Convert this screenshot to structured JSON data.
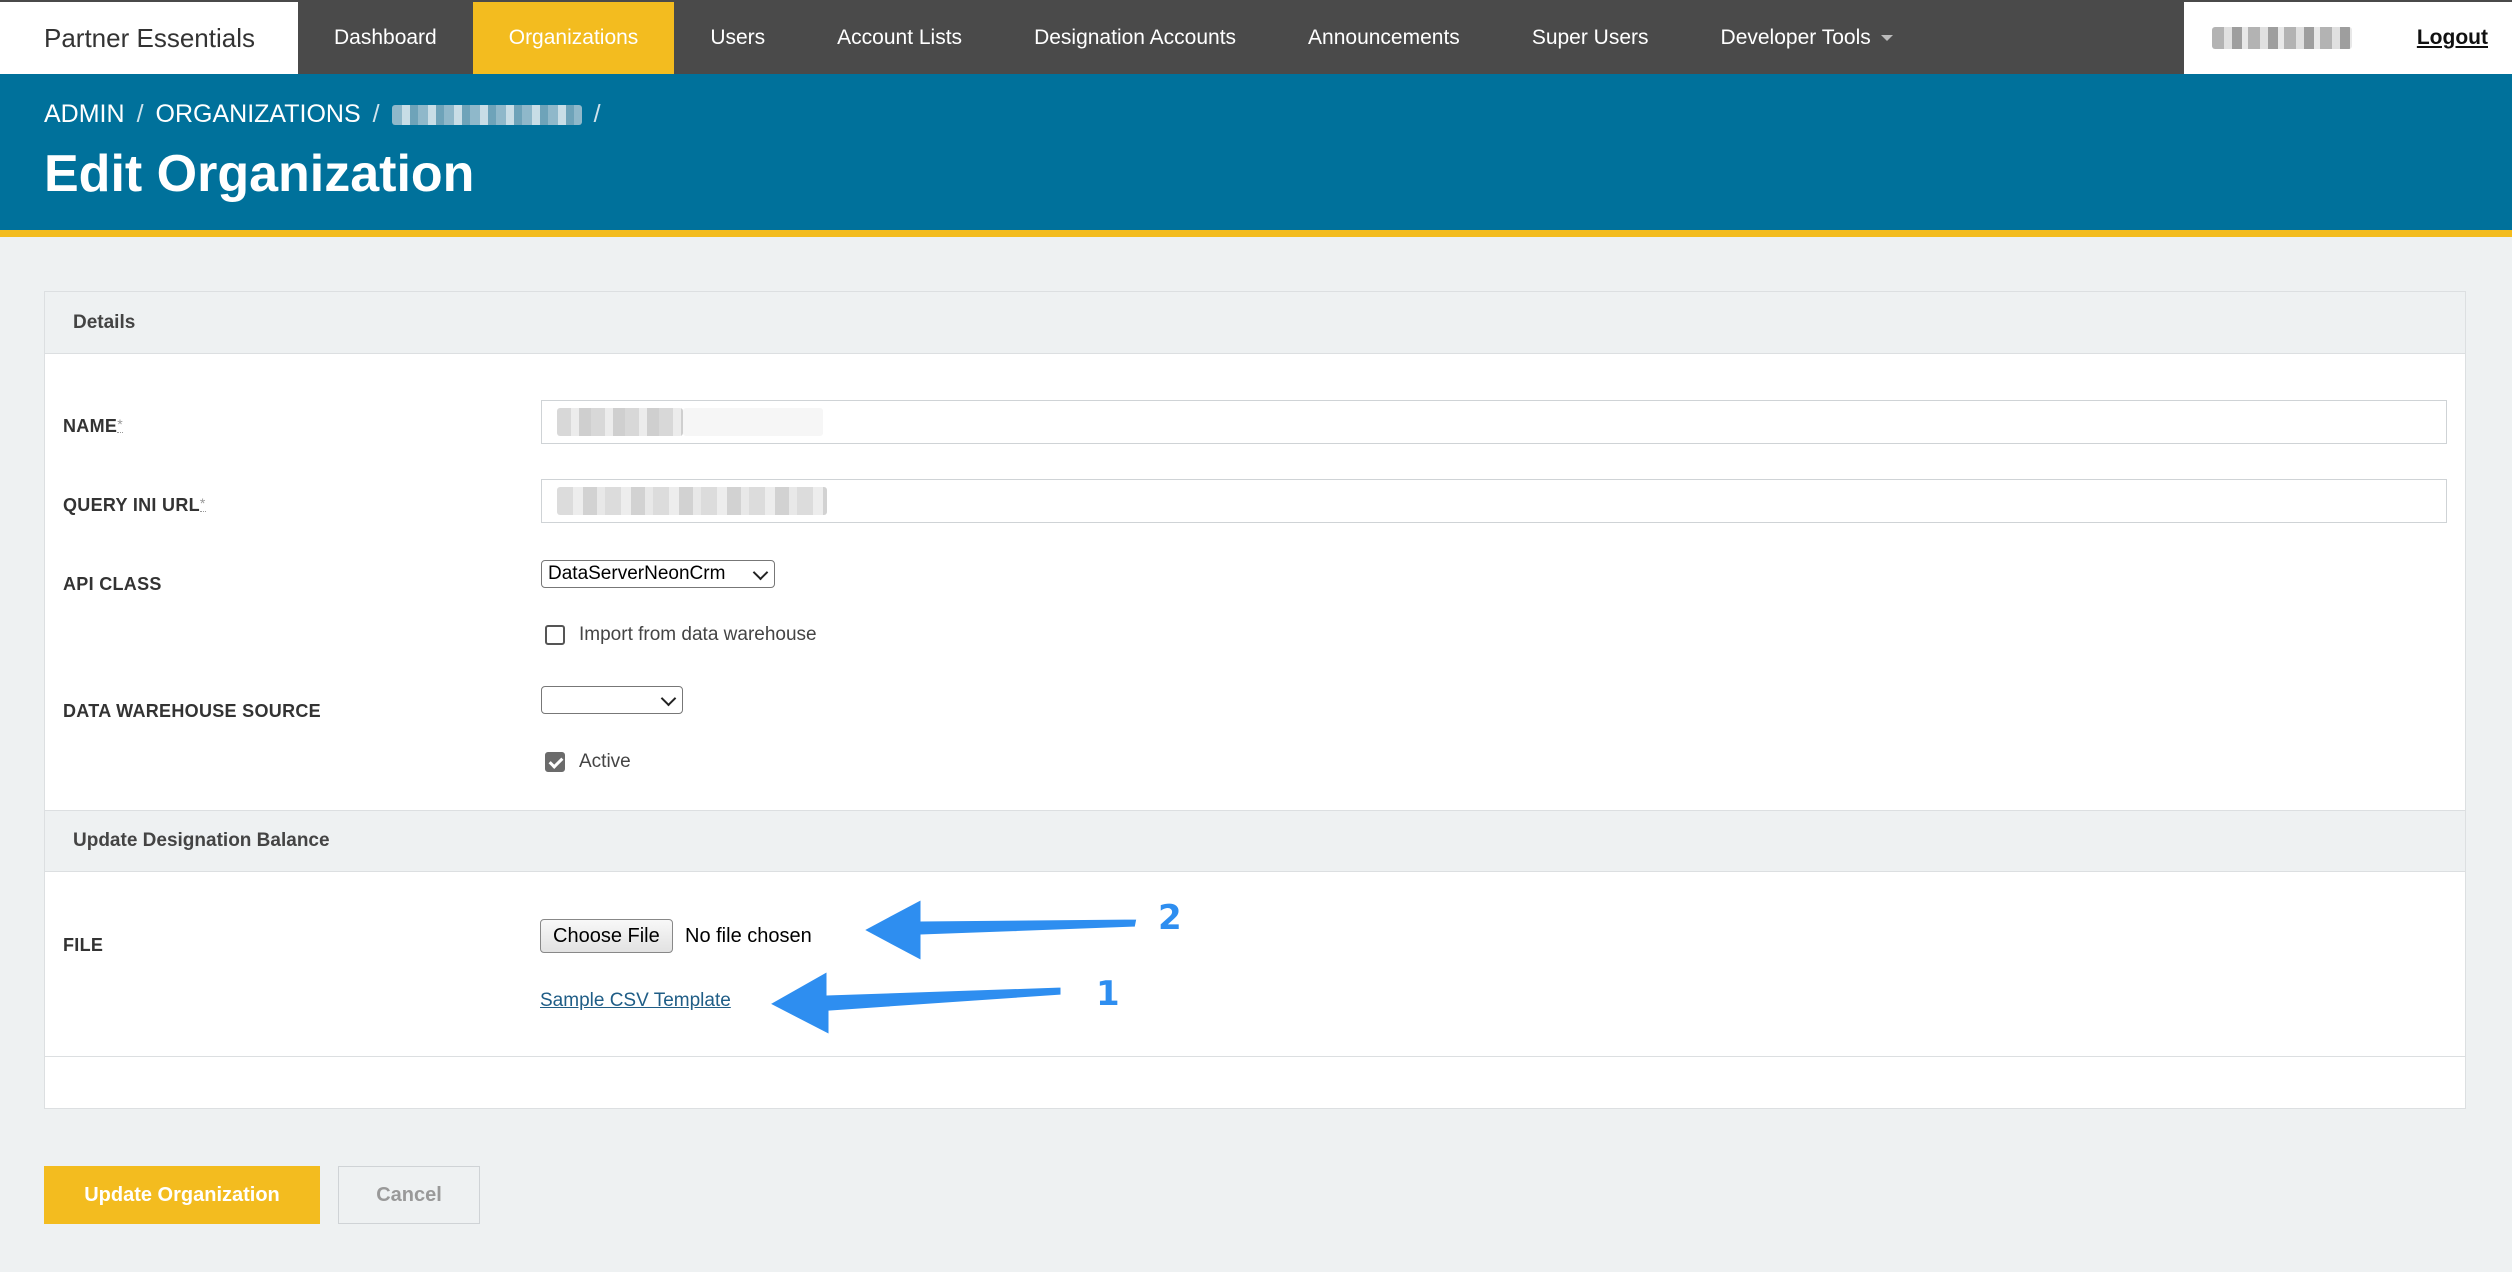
{
  "brand": "Partner Essentials",
  "nav": {
    "items": [
      {
        "label": "Dashboard",
        "active": false
      },
      {
        "label": "Organizations",
        "active": true
      },
      {
        "label": "Users",
        "active": false
      },
      {
        "label": "Account Lists",
        "active": false
      },
      {
        "label": "Designation Accounts",
        "active": false
      },
      {
        "label": "Announcements",
        "active": false
      },
      {
        "label": "Super Users",
        "active": false
      },
      {
        "label": "Developer Tools",
        "active": false,
        "has_caret": true
      }
    ],
    "logout_label": "Logout"
  },
  "breadcrumb": {
    "items": [
      "ADMIN",
      "ORGANIZATIONS"
    ],
    "separator": "/"
  },
  "page_title": "Edit Organization",
  "form": {
    "details_heading": "Details",
    "name_label": "NAME",
    "query_url_label": "QUERY INI URL",
    "required_mark": "*",
    "api_class_label": "API CLASS",
    "api_class_value": "DataServerNeonCrm",
    "import_checkbox_label": "Import from data warehouse",
    "import_checked": false,
    "data_warehouse_label": "DATA WAREHOUSE SOURCE",
    "data_warehouse_value": "",
    "active_label": "Active",
    "active_checked": true,
    "update_balance_heading": "Update Designation Balance",
    "file_label": "FILE",
    "choose_file_label": "Choose File",
    "no_file_text": "No file chosen",
    "sample_link_label": "Sample CSV Template"
  },
  "actions": {
    "submit_label": "Update Organization",
    "cancel_label": "Cancel"
  },
  "annotations": [
    {
      "number": "1",
      "points_to": "Sample CSV Template"
    },
    {
      "number": "2",
      "points_to": "Choose File"
    }
  ],
  "colors": {
    "nav_bg": "#4a4a4a",
    "accent_yellow": "#f3bc1f",
    "header_blue": "#00719b",
    "link": "#1f5d86",
    "annotation_blue": "#2e8ef0"
  }
}
